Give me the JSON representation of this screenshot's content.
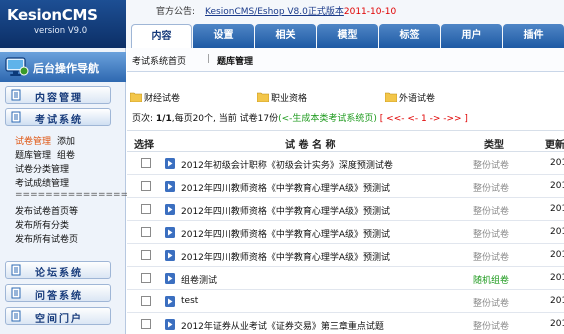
{
  "logo": {
    "brand": "KesionCMS",
    "version": "version V9.0"
  },
  "notice": {
    "label": "官方公告:",
    "link": "KesionCMS/Eshop V8.0正式版本",
    "date": "2011-10-10"
  },
  "tabs": [
    {
      "label": "内容",
      "active": true
    },
    {
      "label": "设置"
    },
    {
      "label": "相关"
    },
    {
      "label": "模型"
    },
    {
      "label": "标签"
    },
    {
      "label": "用户"
    },
    {
      "label": "插件"
    }
  ],
  "sidebar": {
    "title": "后台操作导航",
    "buttons": {
      "content": "内容管理",
      "exam": "考试系统",
      "forum": "论坛系统",
      "qa": "问答系统",
      "portal": "空间门户"
    },
    "links": {
      "paper_manage": "试卷管理",
      "add": "添加",
      "bank_manage": "题库管理",
      "group_paper": "组卷",
      "paper_category": "试卷分类管理",
      "exam_results": "考试成绩管理",
      "divider": "================",
      "publish_home": "发布试卷首页等",
      "publish_categories": "发布所有分类",
      "publish_papers": "发布所有试卷页"
    }
  },
  "breadcrumb": {
    "home": "考试系统首页",
    "separator": "|",
    "current": "题库管理"
  },
  "categories": [
    "财经试卷",
    "职业资格",
    "外语试卷"
  ],
  "pager": {
    "prefix": "页次: ",
    "page": "1/1",
    "per_page": ",每页20个,",
    "current": " 当前 试卷17份",
    "note": "(<-生成本类考试系统页)",
    "nav_open": "[ <<- <- ",
    "nav_page": "1",
    "nav_close": " -> ->> ]"
  },
  "table": {
    "headers": {
      "select": "选择",
      "name": "试 卷 名 称",
      "type": "类型",
      "update": "更新"
    },
    "rows": [
      {
        "title": "2012年初级会计职称《初级会计实务》深度预测试卷",
        "type": "整份试卷",
        "type_green": false,
        "update": "201"
      },
      {
        "title": "2012年四川教师资格《中学教育心理学A级》预测试",
        "type": "整份试卷",
        "type_green": false,
        "update": "201"
      },
      {
        "title": "2012年四川教师资格《中学教育心理学A级》预测试",
        "type": "整份试卷",
        "type_green": false,
        "update": "201"
      },
      {
        "title": "2012年四川教师资格《中学教育心理学A级》预测试",
        "type": "整份试卷",
        "type_green": false,
        "update": "201"
      },
      {
        "title": "2012年四川教师资格《中学教育心理学A级》预测试",
        "type": "整份试卷",
        "type_green": false,
        "update": "201"
      },
      {
        "title": "组卷测试",
        "type": "随机组卷",
        "type_green": true,
        "update": "201"
      },
      {
        "title": "test",
        "type": "整份试卷",
        "type_green": false,
        "update": "201"
      },
      {
        "title": "2012年证券从业考试《证券交易》第三章重点试题",
        "type": "整份试卷",
        "type_green": false,
        "update": "201"
      }
    ]
  },
  "colors": {
    "accent": "#1e5aa4",
    "alert": "#e00000",
    "green": "#1d9a1d"
  }
}
